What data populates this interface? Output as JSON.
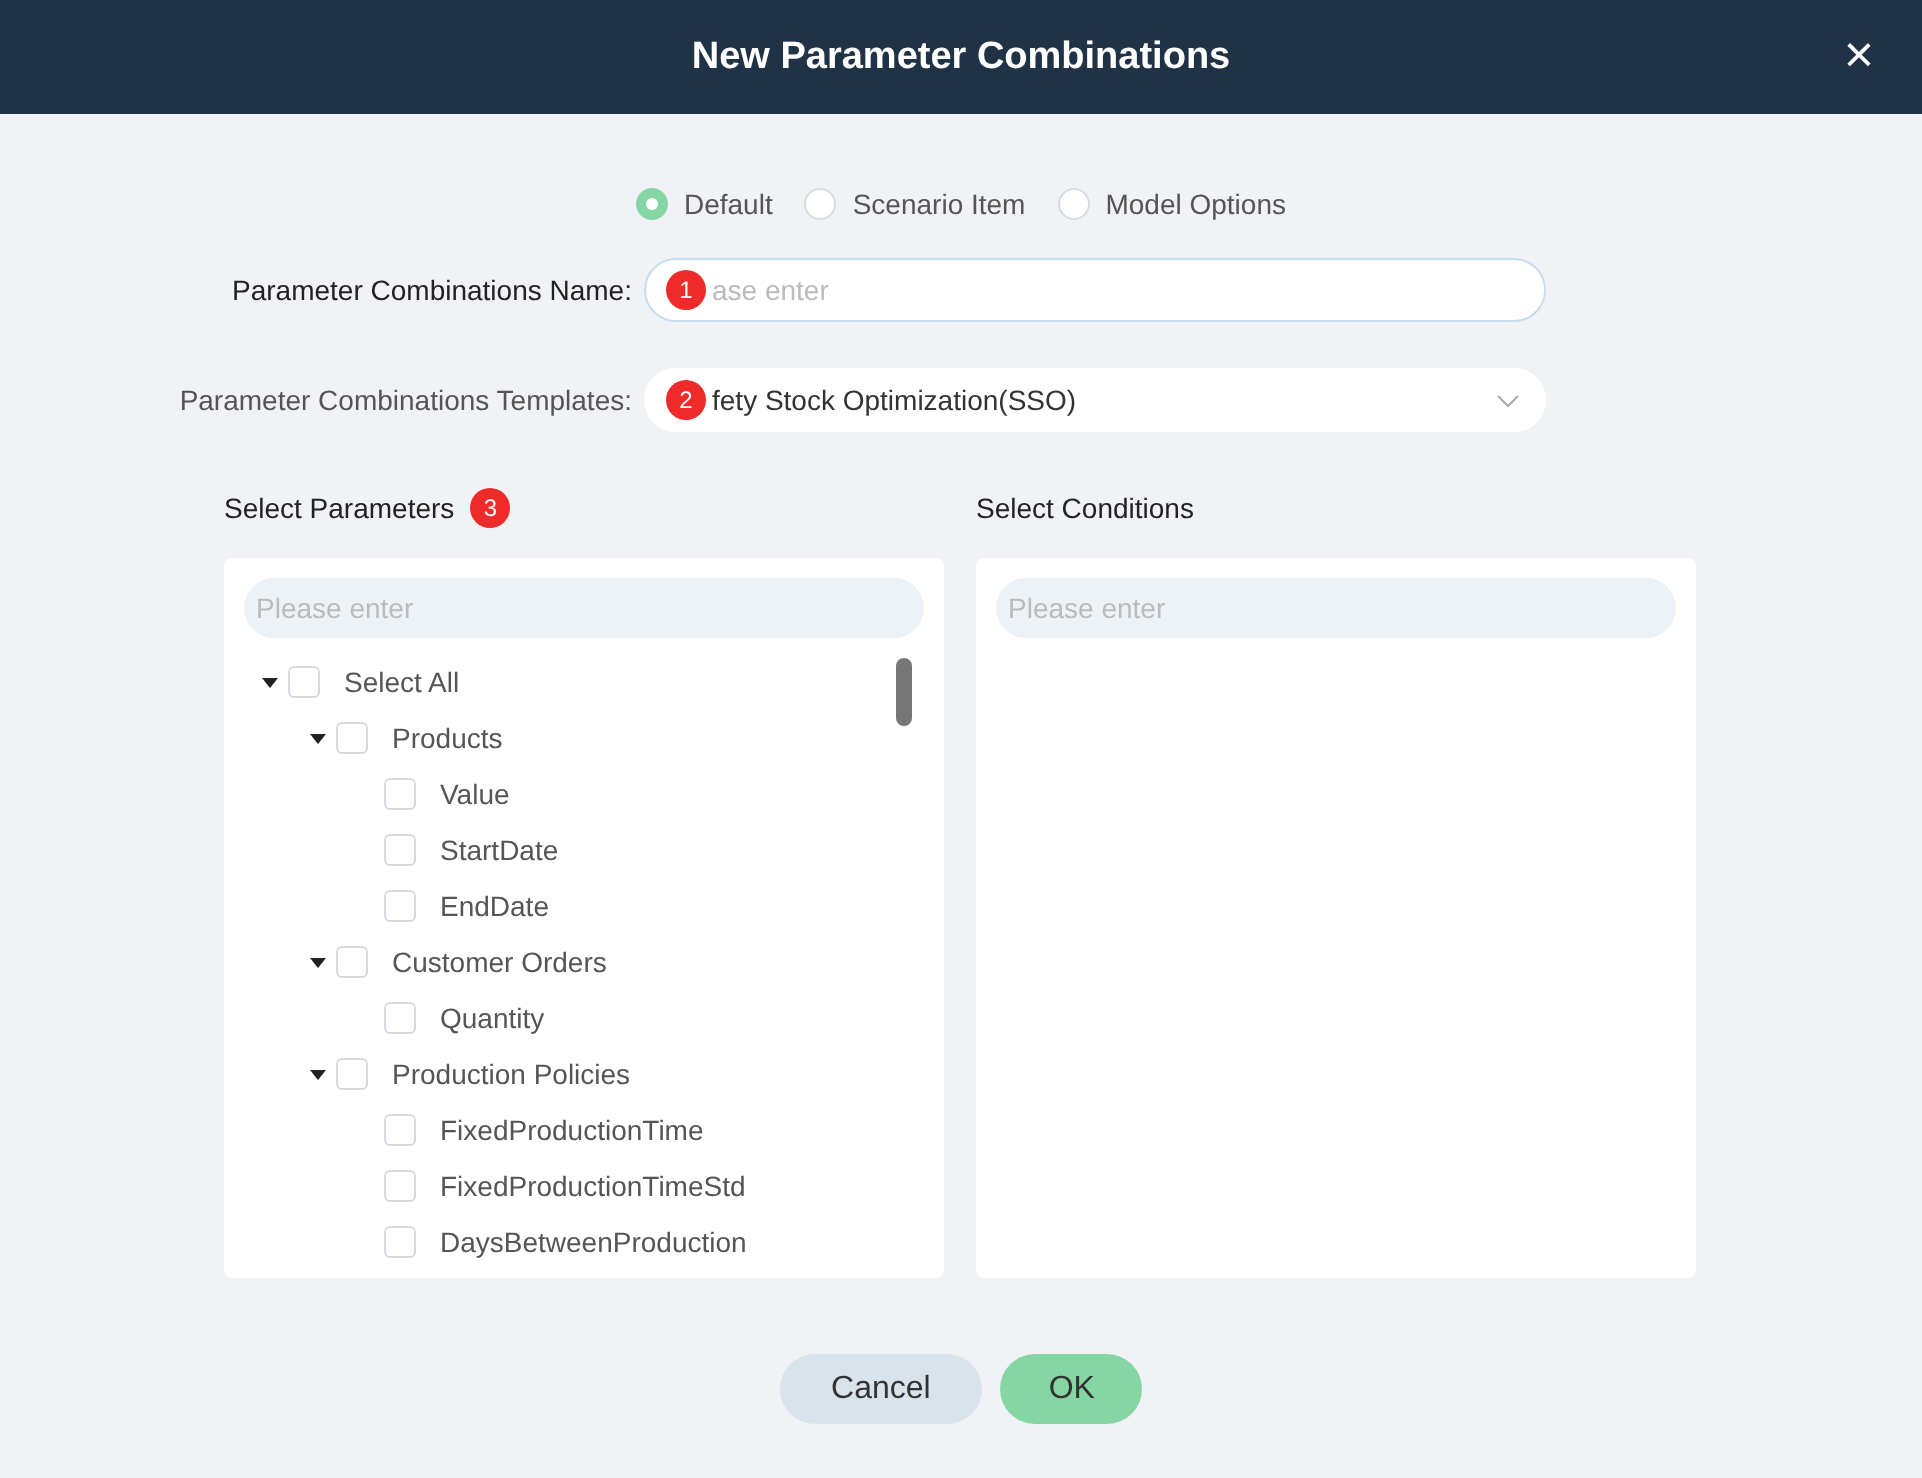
{
  "window": {
    "title": "New Parameter Combinations",
    "close": "×"
  },
  "modes": [
    {
      "label": "Default",
      "selected": true
    },
    {
      "label": "Scenario Item",
      "selected": false
    },
    {
      "label": "Model Options",
      "selected": false
    }
  ],
  "name_field": {
    "label": "Parameter Combinations Name:",
    "placeholder": "ase enter",
    "badge": "1"
  },
  "template_field": {
    "label": "Parameter Combinations Templates:",
    "value": "fety Stock Optimization(SSO)",
    "badge": "2"
  },
  "parameters": {
    "title": "Select Parameters",
    "badge": "3",
    "search": {
      "placeholder": "Please enter"
    },
    "tree": [
      {
        "label": "Select All",
        "checked": false,
        "expanded": true,
        "children": [
          {
            "label": "Products",
            "checked": false,
            "expanded": true,
            "children": [
              {
                "label": "Value",
                "checked": false
              },
              {
                "label": "StartDate",
                "checked": false
              },
              {
                "label": "EndDate",
                "checked": false
              }
            ]
          },
          {
            "label": "Customer Orders",
            "checked": false,
            "expanded": true,
            "children": [
              {
                "label": "Quantity",
                "checked": false
              }
            ]
          },
          {
            "label": "Production Policies",
            "checked": false,
            "expanded": true,
            "children": [
              {
                "label": "FixedProductionTime",
                "checked": false
              },
              {
                "label": "FixedProductionTimeStd",
                "checked": false
              },
              {
                "label": "DaysBetweenProduction",
                "checked": false
              }
            ]
          }
        ]
      }
    ]
  },
  "conditions": {
    "title": "Select Conditions",
    "search": {
      "placeholder": "Please enter"
    }
  },
  "buttons": [
    {
      "label": "Cancel",
      "kind": "secondary"
    },
    {
      "label": "OK",
      "kind": "primary"
    }
  ]
}
